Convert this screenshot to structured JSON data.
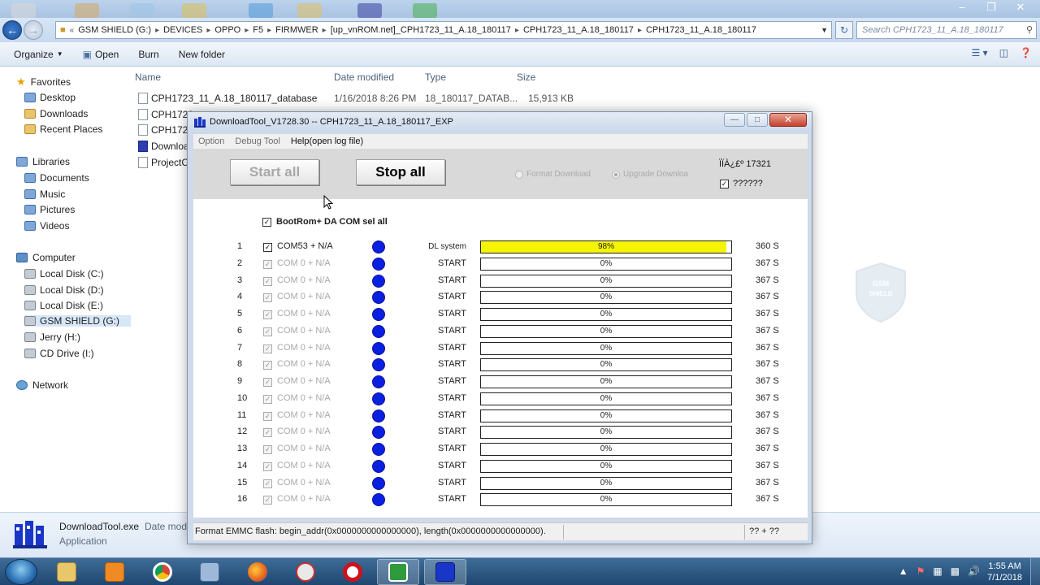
{
  "explorer": {
    "address": {
      "crumbs": [
        "GSM SHIELD (G:)",
        "DEVICES",
        "OPPO",
        "F5",
        "FIRMWER",
        "[up_vnROM.net]_CPH1723_11_A.18_180117",
        "CPH1723_11_A.18_180117",
        "CPH1723_11_A.18_180117"
      ],
      "search_placeholder": "Search CPH1723_11_A.18_180117"
    },
    "commands": {
      "organize": "Organize",
      "open": "Open",
      "burn": "Burn",
      "new_folder": "New folder"
    },
    "nav": {
      "favorites": "Favorites",
      "fav_items": [
        "Desktop",
        "Downloads",
        "Recent Places"
      ],
      "libraries": "Libraries",
      "lib_items": [
        "Documents",
        "Music",
        "Pictures",
        "Videos"
      ],
      "computer": "Computer",
      "drives": [
        "Local Disk (C:)",
        "Local Disk (D:)",
        "Local Disk (E:)",
        "GSM SHIELD (G:)",
        "Jerry (H:)",
        "CD Drive (I:)"
      ],
      "network": "Network"
    },
    "columns": {
      "name": "Name",
      "date": "Date modified",
      "type": "Type",
      "size": "Size"
    },
    "files": [
      {
        "name": "CPH1723_11_A.18_180117_database",
        "date": "1/16/2018 8:26 PM",
        "type": "18_180117_DATAB...",
        "size": "15,913 KB"
      },
      {
        "name": "CPH1723",
        "date": "",
        "type": "",
        "size": ""
      },
      {
        "name": "CPH1723",
        "date": "",
        "type": "",
        "size": ""
      },
      {
        "name": "Downloa",
        "date": "",
        "type": "",
        "size": ""
      },
      {
        "name": "ProjectCo",
        "date": "",
        "type": "",
        "size": ""
      }
    ],
    "details": {
      "name": "DownloadTool.exe",
      "label": "Date modi",
      "type": "Application"
    }
  },
  "dltool": {
    "title": "DownloadTool_V1728.30 -- CPH1723_11_A.18_180117_EXP",
    "menu": [
      "Option",
      "Debug Tool",
      "Help(open log file)"
    ],
    "start_label": "Start all",
    "stop_label": "Stop all",
    "radio_format": "Format Download",
    "radio_upgrade": "Upgrade Downloa",
    "timer_label": "ÏÏÀ¿£º 17321",
    "option_check": "??????",
    "select_all": "BootRom+ DA COM sel all",
    "ports": [
      {
        "num": "1",
        "name": "COM53 + N/A",
        "status": "DL system",
        "progress": 98,
        "pct": "98%",
        "time": "360 S",
        "active": true
      },
      {
        "num": "2",
        "name": "COM 0 + N/A",
        "status": "START",
        "progress": 0,
        "pct": "0%",
        "time": "367 S",
        "active": false
      },
      {
        "num": "3",
        "name": "COM 0 + N/A",
        "status": "START",
        "progress": 0,
        "pct": "0%",
        "time": "367 S",
        "active": false
      },
      {
        "num": "4",
        "name": "COM 0 + N/A",
        "status": "START",
        "progress": 0,
        "pct": "0%",
        "time": "367 S",
        "active": false
      },
      {
        "num": "5",
        "name": "COM 0 + N/A",
        "status": "START",
        "progress": 0,
        "pct": "0%",
        "time": "367 S",
        "active": false
      },
      {
        "num": "6",
        "name": "COM 0 + N/A",
        "status": "START",
        "progress": 0,
        "pct": "0%",
        "time": "367 S",
        "active": false
      },
      {
        "num": "7",
        "name": "COM 0 + N/A",
        "status": "START",
        "progress": 0,
        "pct": "0%",
        "time": "367 S",
        "active": false
      },
      {
        "num": "8",
        "name": "COM 0 + N/A",
        "status": "START",
        "progress": 0,
        "pct": "0%",
        "time": "367 S",
        "active": false
      },
      {
        "num": "9",
        "name": "COM 0 + N/A",
        "status": "START",
        "progress": 0,
        "pct": "0%",
        "time": "367 S",
        "active": false
      },
      {
        "num": "10",
        "name": "COM 0 + N/A",
        "status": "START",
        "progress": 0,
        "pct": "0%",
        "time": "367 S",
        "active": false
      },
      {
        "num": "11",
        "name": "COM 0 + N/A",
        "status": "START",
        "progress": 0,
        "pct": "0%",
        "time": "367 S",
        "active": false
      },
      {
        "num": "12",
        "name": "COM 0 + N/A",
        "status": "START",
        "progress": 0,
        "pct": "0%",
        "time": "367 S",
        "active": false
      },
      {
        "num": "13",
        "name": "COM 0 + N/A",
        "status": "START",
        "progress": 0,
        "pct": "0%",
        "time": "367 S",
        "active": false
      },
      {
        "num": "14",
        "name": "COM 0 + N/A",
        "status": "START",
        "progress": 0,
        "pct": "0%",
        "time": "367 S",
        "active": false
      },
      {
        "num": "15",
        "name": "COM 0 + N/A",
        "status": "START",
        "progress": 0,
        "pct": "0%",
        "time": "367 S",
        "active": false
      },
      {
        "num": "16",
        "name": "COM 0 + N/A",
        "status": "START",
        "progress": 0,
        "pct": "0%",
        "time": "367 S",
        "active": false
      }
    ],
    "status_main": "Format EMMC flash:  begin_addr(0x0000000000000000), length(0x0000000000000000).",
    "status_right": "?? + ??"
  },
  "taskbar": {
    "time": "1:55 AM",
    "date": "7/1/2018",
    "apps": [
      "explorer-icon",
      "media-player-icon",
      "chrome-icon",
      "network-tool-icon",
      "firefox-icon",
      "snipping-icon",
      "opera-icon",
      "camtasia-icon",
      "downloadtool-icon"
    ]
  },
  "colors": {
    "progress_fill": "#f5f500",
    "port_dot": "#0b1fe0",
    "titlebar": "#bcd3ec",
    "taskbar": "#2a5580"
  }
}
